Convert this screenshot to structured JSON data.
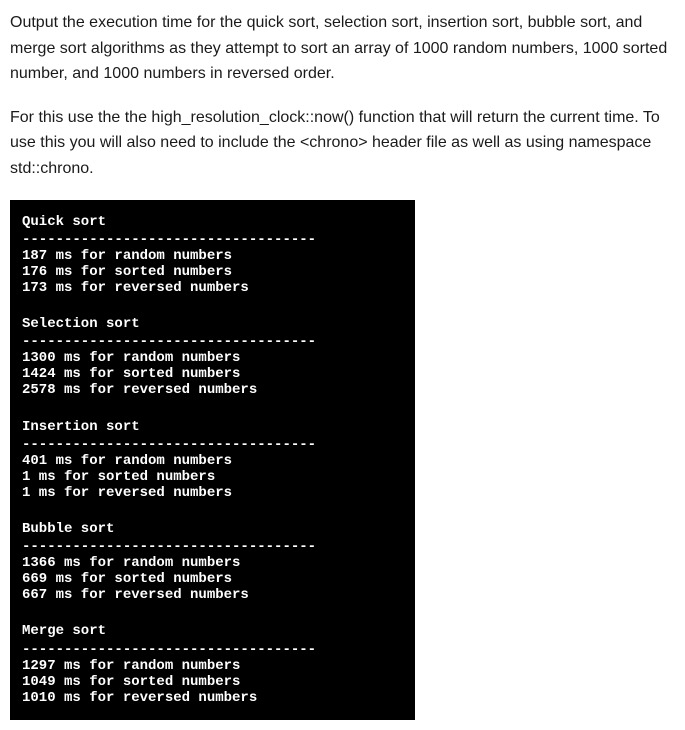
{
  "description": {
    "para1": "Output the execution time for the quick sort, selection sort, insertion sort, bubble sort, and merge sort algorithms as they attempt to sort an array of 1000 random numbers, 1000 sorted number, and 1000 numbers in reversed order.",
    "para2": "For this use the the high_resolution_clock::now() function that will return the current time. To use this you will also need to include the <chrono> header file as well as using namespace std::chrono."
  },
  "terminal": {
    "divider": "-----------------------------------",
    "sections": [
      {
        "title": "Quick sort",
        "lines": [
          "187 ms for random numbers",
          "176 ms for sorted numbers",
          "173 ms for reversed numbers"
        ]
      },
      {
        "title": "Selection sort",
        "lines": [
          "1300 ms for random numbers",
          "1424 ms for sorted numbers",
          "2578 ms for reversed numbers"
        ]
      },
      {
        "title": "Insertion sort",
        "lines": [
          "401 ms for random numbers",
          "1 ms for sorted numbers",
          "1 ms for reversed numbers"
        ]
      },
      {
        "title": "Bubble sort",
        "lines": [
          "1366 ms for random numbers",
          "669 ms for sorted numbers",
          "667 ms for reversed numbers"
        ]
      },
      {
        "title": "Merge sort",
        "lines": [
          "1297 ms for random numbers",
          "1049 ms for sorted numbers",
          "1010 ms for reversed numbers"
        ]
      }
    ]
  }
}
